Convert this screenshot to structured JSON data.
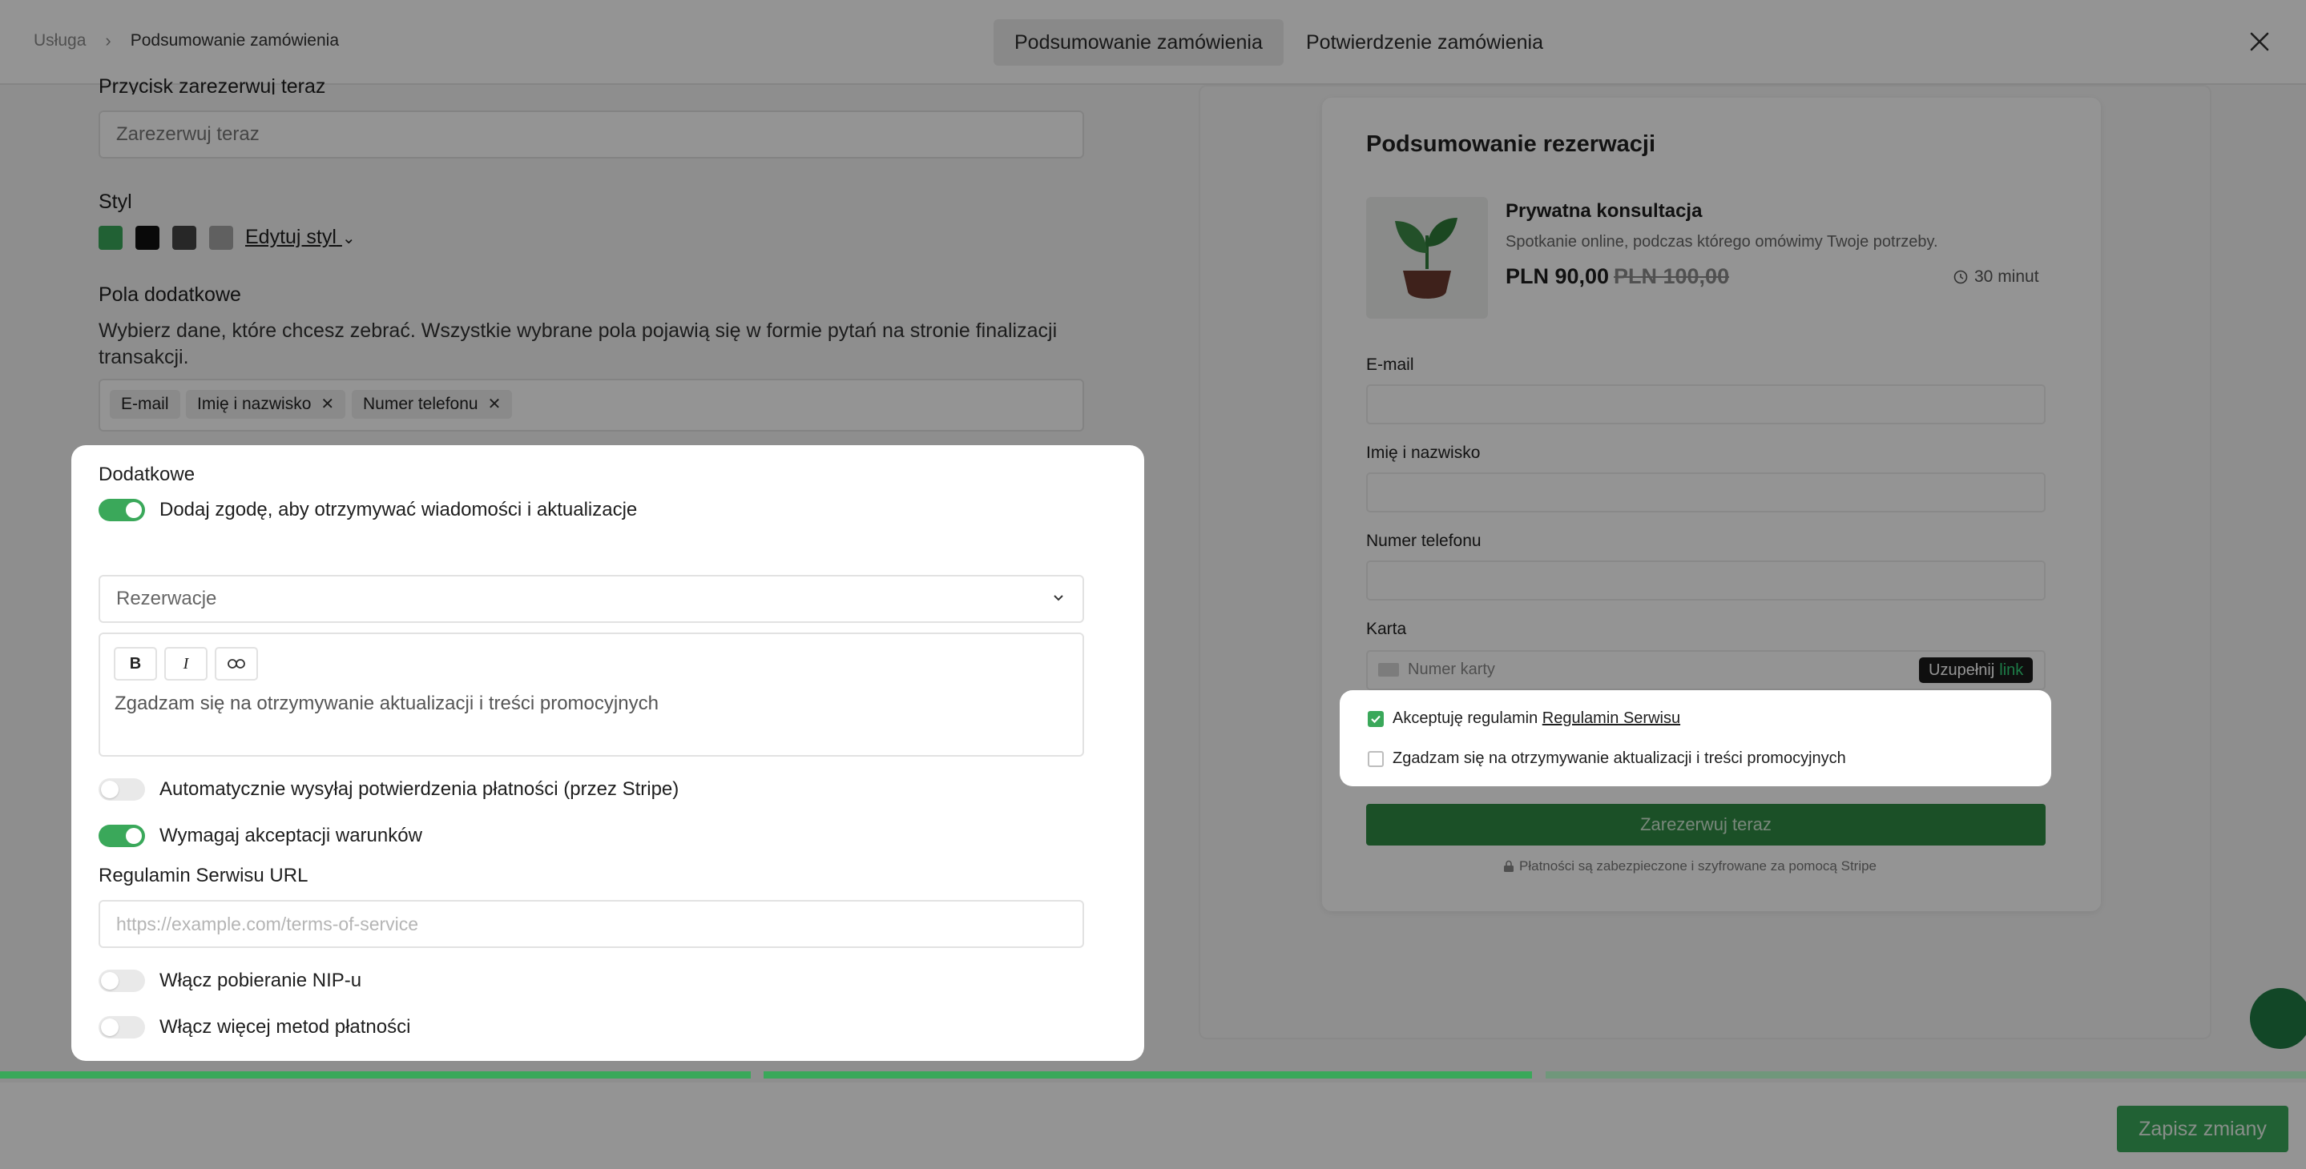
{
  "breadcrumb": {
    "parent": "Usługa",
    "current": "Podsumowanie zamówienia"
  },
  "tabs": [
    {
      "label": "Podsumowanie zamówienia",
      "active": true
    },
    {
      "label": "Potwierdzenie zamówienia",
      "active": false
    }
  ],
  "editor": {
    "button_label": "Przycisk zarezerwuj teraz",
    "button_value": "Zarezerwuj teraz",
    "style_label": "Styl",
    "swatch_colors": [
      "#3aa85a",
      "#111111",
      "#444444",
      "#a6a6a6"
    ],
    "edit_style": "Edytuj styl",
    "extra_fields_title": "Pola dodatkowe",
    "extra_fields_desc": "Wybierz dane, które chcesz zebrać. Wszystkie wybrane pola pojawią się w formie pytań na stronie finalizacji transakcji.",
    "chips": [
      "E-mail",
      "Imię i nazwisko",
      "Numer telefonu"
    ]
  },
  "modal": {
    "title": "Dodatkowe",
    "consent_toggle": {
      "label": "Dodaj zgodę, aby otrzymywać wiadomości i aktualizacje",
      "on": true
    },
    "select_value": "Rezerwacje",
    "toolbar": {
      "bold": "B",
      "italic": "I"
    },
    "consent_text": "Zgadzam się na otrzymywanie aktualizacji i treści promocyjnych",
    "auto_receipt": {
      "label": "Automatycznie wysyłaj potwierdzenia płatności (przez Stripe)",
      "on": false
    },
    "require_terms": {
      "label": "Wymagaj akceptacji warunków",
      "on": true
    },
    "terms_url_label": "Regulamin Serwisu URL",
    "terms_url_placeholder": "https://example.com/terms-of-service",
    "nip": {
      "label": "Włącz pobieranie NIP-u",
      "on": false
    },
    "more_methods": {
      "label": "Włącz więcej metod płatności",
      "on": false
    }
  },
  "preview": {
    "title": "Podsumowanie rezerwacji",
    "product_name": "Prywatna konsultacja",
    "product_desc": "Spotkanie online, podczas którego omówimy Twoje potrzeby.",
    "price": "PLN 90,00",
    "old_price": "PLN 100,00",
    "duration": "30 minut",
    "field_labels": [
      "E-mail",
      "Imię i nazwisko",
      "Numer telefonu"
    ],
    "card_label": "Karta",
    "card_placeholder": "Numer karty",
    "autofill": "Uzupełnij",
    "autofill_link": "link",
    "terms_prefix": "Akceptuję regulamin ",
    "terms_link": "Regulamin Serwisu",
    "promo_consent": "Zgadzam się na otrzymywanie aktualizacji i treści promocyjnych",
    "reserve_button": "Zarezerwuj teraz",
    "secure_note": "Płatności są zabezpieczone i szyfrowane za pomocą Stripe"
  },
  "footer": {
    "save_button": "Zapisz zmiany",
    "progress_steps_done": 2,
    "progress_steps_total": 3
  },
  "colors": {
    "accent": "#3aa85a",
    "button_dark_green": "#2f8a44"
  }
}
